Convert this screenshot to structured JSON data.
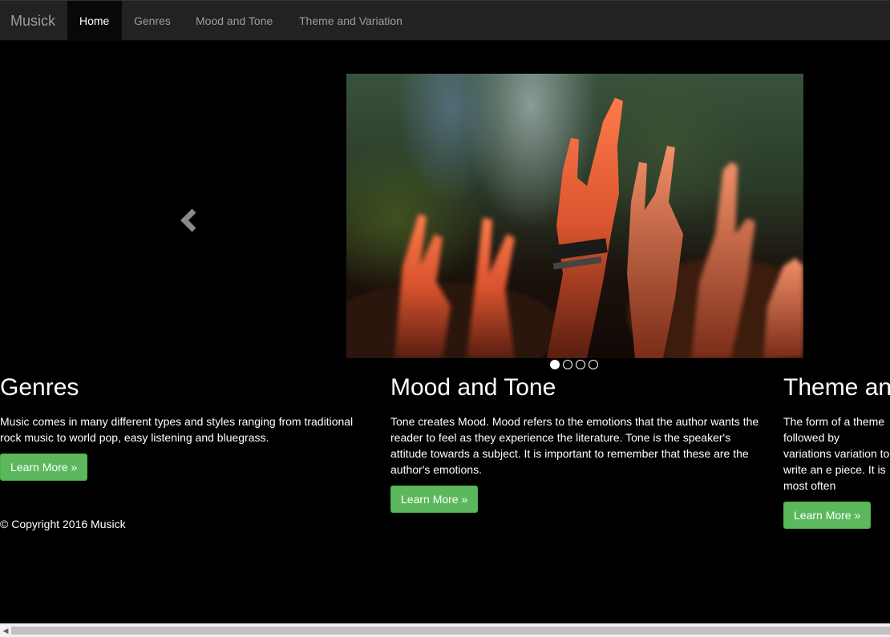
{
  "navbar": {
    "brand": "Musick",
    "items": [
      {
        "label": "Home",
        "active": true
      },
      {
        "label": "Genres",
        "active": false
      },
      {
        "label": "Mood and Tone",
        "active": false
      },
      {
        "label": "Theme and Variation",
        "active": false
      }
    ]
  },
  "carousel": {
    "image": "concert-crowd-hands-photo",
    "prev_icon": "chevron-left-icon",
    "slide_count": 4,
    "active_slide": 1
  },
  "columns": [
    {
      "heading": "Genres",
      "text": "Music comes in many different types and styles ranging from traditional rock music to world pop, easy listening and bluegrass.",
      "button": "Learn More »"
    },
    {
      "heading": "Mood and Tone",
      "text": "Tone creates Mood. Mood refers to the emotions that the author wants the reader to feel as they experience the literature. Tone is the speaker's attitude towards a subject. It is important to remember that these are the author's emotions.",
      "button": "Learn More »"
    },
    {
      "heading": "Theme an",
      "text": "The form of a theme followed by variations variation to write an e piece. It is most often",
      "button": "Learn More »"
    }
  ],
  "footer": {
    "copyright": "© Copyright 2016 Musick"
  },
  "colors": {
    "navbar_bg": "#222222",
    "active_nav_bg": "#080808",
    "button_green": "#5cb85c",
    "page_bg": "#000000"
  }
}
